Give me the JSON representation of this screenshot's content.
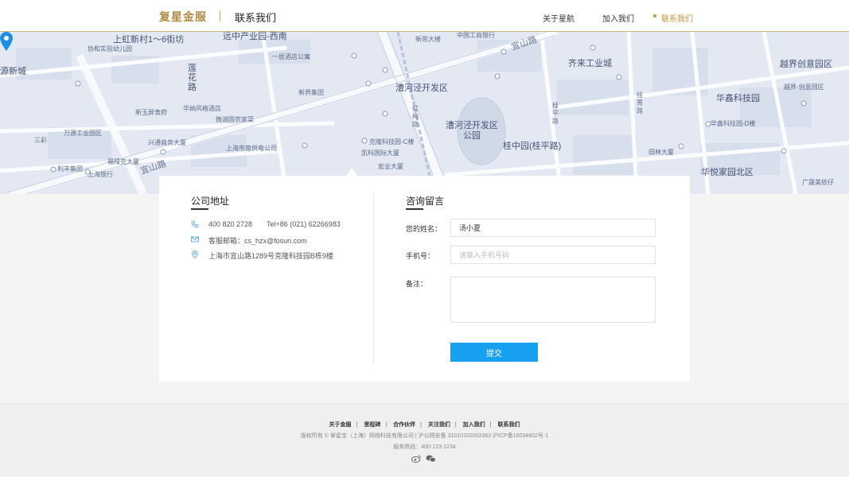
{
  "header": {
    "logo": "复星金服",
    "page_title": "联系我们",
    "nav": [
      {
        "label": "关于星航"
      },
      {
        "label": "加入我们"
      },
      {
        "label": "联系我们",
        "active": true
      }
    ],
    "accent_color": "#c9953b"
  },
  "map": {
    "labels": {
      "l1": "上虹新村1～6街坊",
      "l2": "远中产业园-西南",
      "l3": "协和实验幼儿园",
      "l4": "源新城",
      "l5": "莲花路",
      "l6": "一居酒店公寓",
      "l7": "新思大楼",
      "l8": "中国工商银行",
      "l9": "宜山路",
      "l10": "齐来工业城",
      "l11": "越界创意园区",
      "l12": "新界集团",
      "l13": "漕河泾开发区",
      "l14": "华鑫科技园",
      "l15": "微湖国农家菜",
      "l16": "万源工业园区",
      "l17": "兴通商务大厦",
      "l18": "上海市南供电公司",
      "l19": "漕河泾开发区公园",
      "l20": "桂中园(桂平路)",
      "l21": "克隆科技园-C楼",
      "l22": "凯科国际大厦",
      "l23": "福禄克大厦",
      "l24": "利丰集团",
      "l25": "上海银行",
      "l26": "宜山路",
      "l27": "华悦家园北区",
      "l28": "广晟美侬仔",
      "l29": "桂平路",
      "l30": "桂菁路",
      "l31": "虹梅路",
      "l32": "宏业大厦",
      "l33": "三彩",
      "l34": "新玉屏食府",
      "l35": "华鑫科技园-D楼",
      "l36": "华纳风格酒店",
      "l37": "田林大厦",
      "l38": "越界·创意园区"
    }
  },
  "address": {
    "title": "公司地址",
    "phone": "400 820 2728",
    "tel": "Tel+86 (021) 62266983",
    "email": "客服邮箱：cs_hzx@fosun.com",
    "location": "上海市宜山路1289号克隆科技园B栋9楼"
  },
  "form": {
    "title": "咨询留言",
    "name_label": "您的姓名：",
    "name_value": "汤小夏",
    "phone_label": "手机号：",
    "phone_placeholder": "请输入手机号码",
    "note_label": "备注：",
    "note_value": "",
    "submit_label": "提交",
    "submit_color": "#18a0f0"
  },
  "footer": {
    "links": [
      "关于金服",
      "里程碑",
      "合作伙伴",
      "关注我们",
      "加入我们",
      "联系我们"
    ],
    "copyright": "版权所有 © 掌星宝（上海）网络科技有限公司  |  沪公网安备 31010102002363  沪ICP备15034802号-1",
    "hotline": "服务热线：400-123-1234",
    "icons": [
      "weibo-icon",
      "wechat-icon"
    ]
  }
}
